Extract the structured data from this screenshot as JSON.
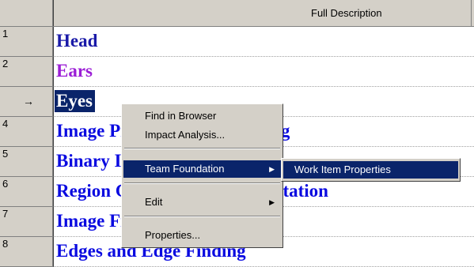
{
  "grid": {
    "column_header": "Full Description",
    "rows": [
      {
        "num": "1",
        "text": "Head",
        "color": "#1a1aa8",
        "selected": false,
        "current": false
      },
      {
        "num": "2",
        "text": "Ears",
        "color": "#9b1ed6",
        "selected": false,
        "current": false
      },
      {
        "num": "",
        "text": "Eyes",
        "color": "#0a246a",
        "selected": true,
        "current": true,
        "row_marker": "→"
      },
      {
        "num": "4",
        "text": "Image Processing and Sensing",
        "color": "#0a0ae0",
        "selected": false,
        "current": false
      },
      {
        "num": "5",
        "text": "Binary Images",
        "color": "#0a0ae0",
        "selected": false,
        "current": false
      },
      {
        "num": "6",
        "text": "Region Growing and Segmentation",
        "color": "#0a0ae0",
        "selected": false,
        "current": false
      },
      {
        "num": "7",
        "text": "Image Filtering",
        "color": "#0a0ae0",
        "selected": false,
        "current": false
      },
      {
        "num": "8",
        "text": "Edges and Edge Finding",
        "color": "#0a0ae0",
        "selected": false,
        "current": false
      }
    ]
  },
  "context_menu": {
    "items": [
      {
        "label": "Find in Browser"
      },
      {
        "label": "Impact Analysis..."
      },
      {
        "label": "Team Foundation",
        "submenu": true,
        "active": true
      },
      {
        "label": "Edit",
        "submenu": true
      },
      {
        "label": "Properties..."
      }
    ]
  },
  "submenu": {
    "items": [
      {
        "label": "Work Item Properties",
        "active": true
      }
    ]
  }
}
